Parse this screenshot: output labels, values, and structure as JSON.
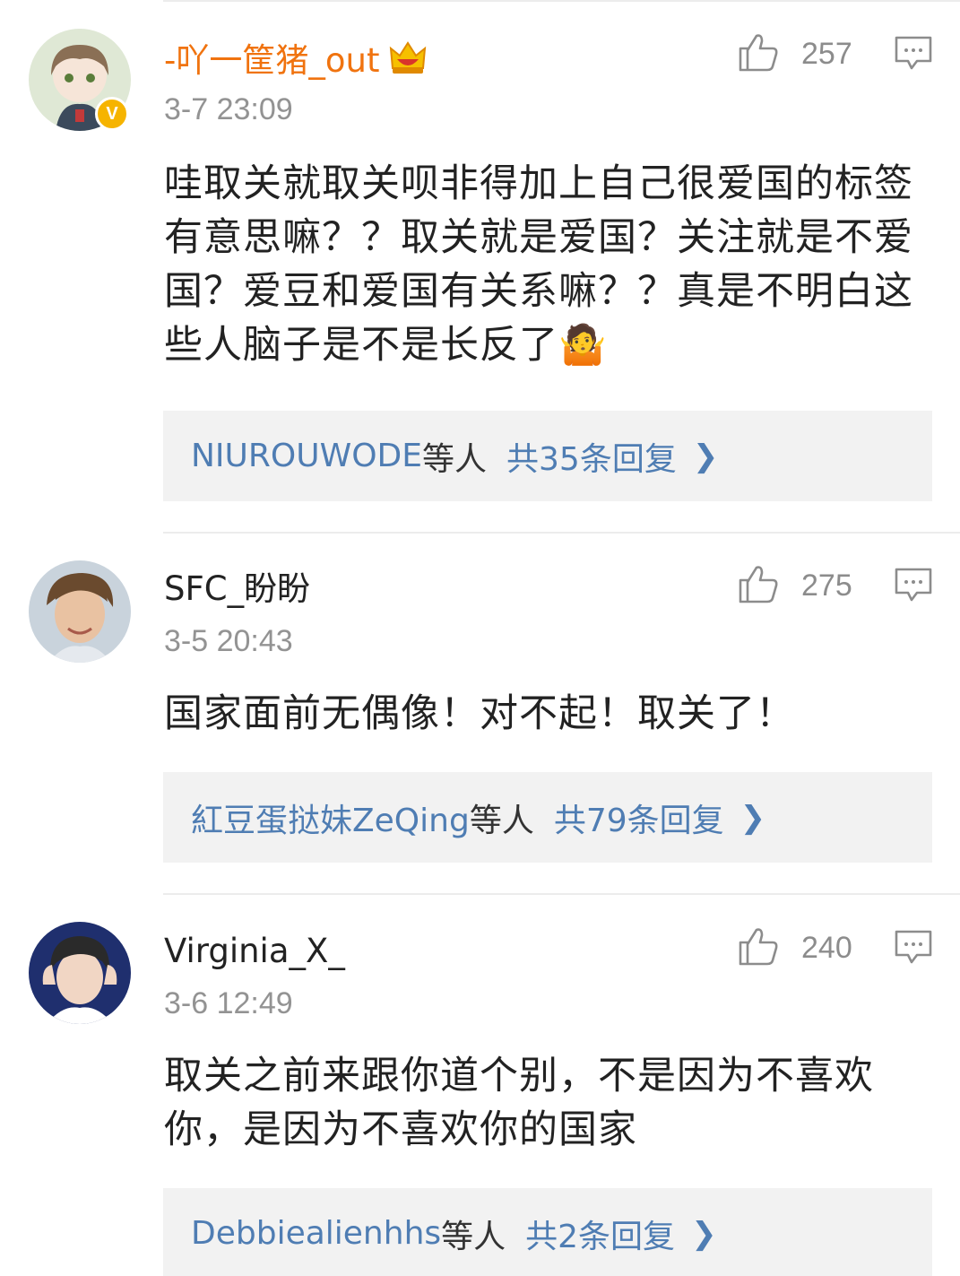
{
  "comments": [
    {
      "username": "-吖一筐猪_out",
      "time": "3-7 23:09",
      "likes": "257",
      "text": "哇取关就取关呗非得加上自己很爱国的标签有意思嘛？？取关就是爱国？关注就是不爱国？爱豆和爱国有关系嘛？？真是不明白这些人脑子是不是长反了🤷",
      "reply_names": "NIUROUWODE",
      "reply_suffix": "等人",
      "reply_count": "共35条回复",
      "badge": "V"
    },
    {
      "username": "SFC_盼盼",
      "time": "3-5 20:43",
      "likes": "275",
      "text": "国家面前无偶像！对不起！取关了！",
      "reply_names": "紅豆蛋挞妹ZeQing",
      "reply_suffix": "等人",
      "reply_count": "共79条回复"
    },
    {
      "username": "Virginia_X_",
      "time": "3-6 12:49",
      "likes": "240",
      "text": "取关之前来跟你道个别，不是因为不喜欢你，是因为不喜欢你的国家",
      "reply_names": "Debbiealienhhs",
      "reply_suffix": "等人",
      "reply_count": "共2条回复"
    }
  ],
  "icons": {
    "like": "thumbs-up-icon",
    "reply": "comment-icon",
    "chevron": "chevron-right-icon",
    "crown": "crown-icon"
  },
  "colors": {
    "vip_name": "#f0730f",
    "link": "#4f7db3",
    "muted": "#939393",
    "reply_bg": "#f2f2f2",
    "badge": "#f6b400"
  }
}
